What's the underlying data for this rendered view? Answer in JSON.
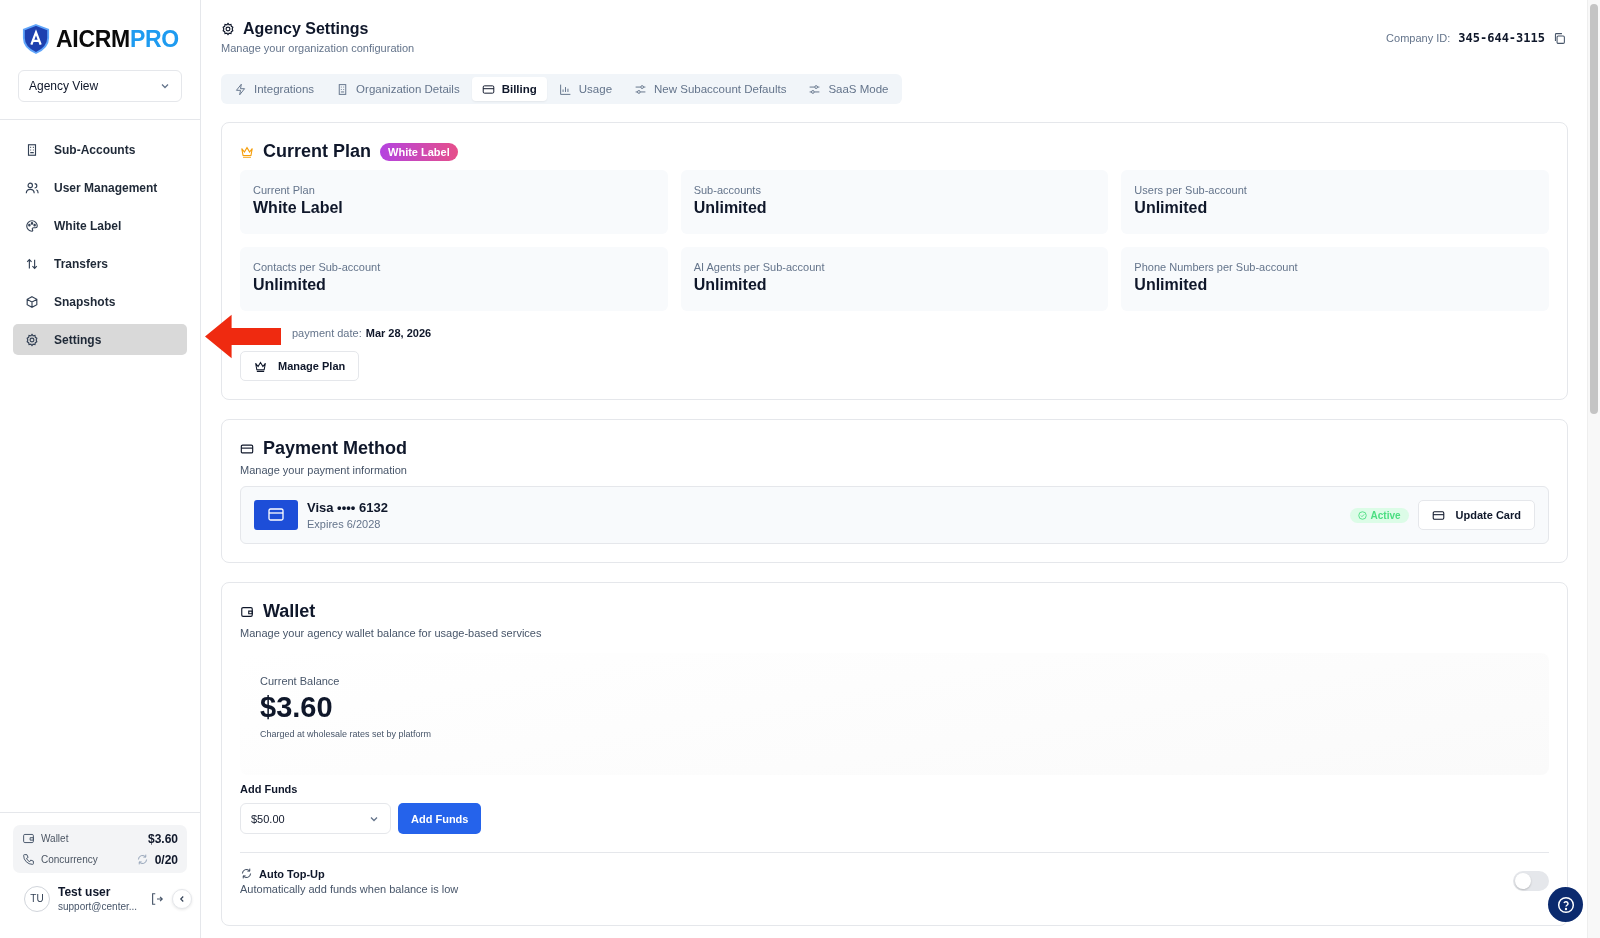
{
  "brand": {
    "name_main": "AICRM",
    "name_accent": "PRO"
  },
  "view_selector": {
    "value": "Agency View"
  },
  "nav": [
    {
      "label": "Sub-Accounts",
      "selected": false
    },
    {
      "label": "User Management",
      "selected": false
    },
    {
      "label": "White Label",
      "selected": false
    },
    {
      "label": "Transfers",
      "selected": false
    },
    {
      "label": "Snapshots",
      "selected": false
    },
    {
      "label": "Settings",
      "selected": true
    }
  ],
  "sidebar_footer": {
    "wallet": {
      "label": "Wallet",
      "value": "$3.60"
    },
    "concurrency": {
      "label": "Concurrency",
      "value": "0/20"
    },
    "user": {
      "initials": "TU",
      "name": "Test user",
      "email": "support@center..."
    }
  },
  "header": {
    "title": "Agency Settings",
    "subtitle": "Manage your organization configuration",
    "company_id_label": "Company ID:",
    "company_id": "345-644-3115"
  },
  "tabs": [
    {
      "label": "Integrations",
      "selected": false
    },
    {
      "label": "Organization Details",
      "selected": false
    },
    {
      "label": "Billing",
      "selected": true
    },
    {
      "label": "Usage",
      "selected": false
    },
    {
      "label": "New Subaccount Defaults",
      "selected": false
    },
    {
      "label": "SaaS Mode",
      "selected": false
    }
  ],
  "current_plan": {
    "title": "Current Plan",
    "badge": "White Label",
    "stats": [
      {
        "label": "Current Plan",
        "value": "White Label"
      },
      {
        "label": "Sub-accounts",
        "value": "Unlimited"
      },
      {
        "label": "Users per Sub-account",
        "value": "Unlimited"
      },
      {
        "label": "Contacts per Sub-account",
        "value": "Unlimited"
      },
      {
        "label": "AI Agents per Sub-account",
        "value": "Unlimited"
      },
      {
        "label": "Phone Numbers per Sub-account",
        "value": "Unlimited"
      }
    ],
    "next_payment": {
      "label": "payment date:",
      "value": "Mar 28, 2026"
    },
    "button": "Manage Plan"
  },
  "payment_method": {
    "title": "Payment Method",
    "subtitle": "Manage your payment information",
    "card": {
      "name": "Visa •••• 6132",
      "expires": "Expires 6/2028",
      "status": "Active"
    },
    "button": "Update Card"
  },
  "wallet": {
    "title": "Wallet",
    "subtitle": "Manage your agency wallet balance for usage-based services",
    "balance_label": "Current Balance",
    "balance": "$3.60",
    "balance_note": "Charged at wholesale rates set by platform",
    "add_funds_label": "Add Funds",
    "amount": "$50.00",
    "button": "Add Funds",
    "auto_topup": {
      "title": "Auto Top-Up",
      "subtitle": "Automatically add funds when balance is low",
      "on": false
    }
  }
}
